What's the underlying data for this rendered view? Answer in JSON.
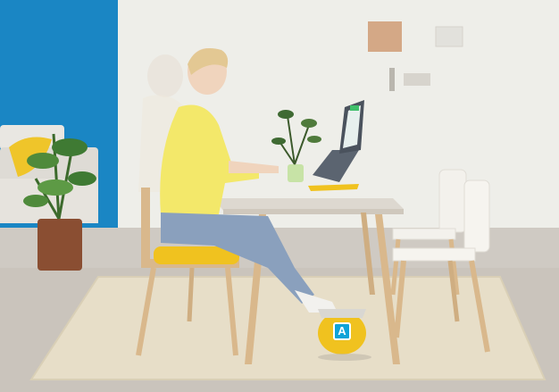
{
  "scene": {
    "description_icon": "office-chair-footrest-scene",
    "colors": {
      "blue_wall": "#1a86c4",
      "white_wall": "#ecebe7",
      "floor": "#cfcac3",
      "rug": "#e7dec8",
      "wood": "#d9b88c",
      "cushion_yellow": "#f0c21f",
      "sweater_yellow": "#f3e86a",
      "jeans": "#8aa0bd",
      "badge_blue": "#0fa3d8"
    }
  },
  "callouts": [
    {
      "id": "a",
      "label": "A"
    }
  ]
}
